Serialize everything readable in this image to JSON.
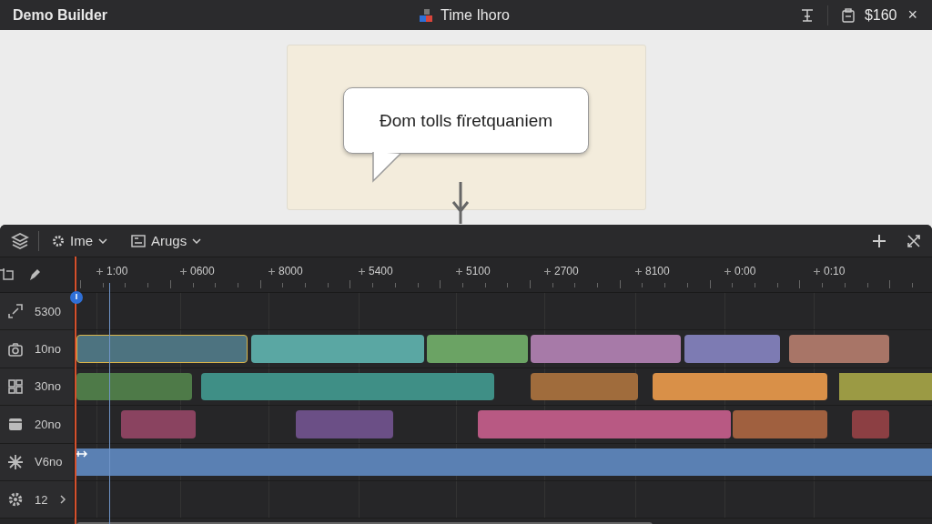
{
  "title_bar": {
    "app_name": "Demo Builder",
    "document_title": "Time Ihoro",
    "price": "$160",
    "close": "×"
  },
  "canvas": {
    "callout": "Đom tolls fïretquaniem"
  },
  "timeline": {
    "toolbar": [
      {
        "label": "Ime"
      },
      {
        "label": "Arugs"
      }
    ],
    "ruler": [
      "1:00",
      "0600",
      "8000",
      "5400",
      "5100",
      "2700",
      "8100",
      "0:00",
      "0:10"
    ],
    "tracks": [
      {
        "label": "5300"
      },
      {
        "label": "10no",
        "clips": [
          {
            "color": "#4d7380",
            "selected": true
          },
          {
            "color": "#5aa7a3",
            "selected": false
          },
          {
            "color": "#6ba364",
            "selected": false
          },
          {
            "color": "#a77aa8",
            "selected": false
          },
          {
            "color": "#7d7bb3",
            "selected": false
          },
          {
            "color": "#a87567",
            "selected": false
          }
        ]
      },
      {
        "label": "30no",
        "clips": [
          {
            "color": "#4e7a48",
            "selected": false
          },
          {
            "color": "#3f8f86",
            "selected": false
          },
          {
            "color": "#a06c3c",
            "selected": false
          },
          {
            "color": "#d99048",
            "selected": false
          },
          {
            "color": "#9b9a44",
            "selected": false
          }
        ]
      },
      {
        "label": "20no",
        "clips": [
          {
            "color": "#8a4360",
            "selected": false
          },
          {
            "color": "#6b4f86",
            "selected": false
          },
          {
            "color": "#b85983",
            "selected": false
          },
          {
            "color": "#a0603f",
            "selected": false
          },
          {
            "color": "#8c3f43",
            "selected": false
          }
        ]
      },
      {
        "label": "V6no",
        "clips": [
          {
            "color": "#5a80b3",
            "selected": false
          }
        ]
      },
      {
        "label": "12",
        "expanded": false
      }
    ]
  }
}
